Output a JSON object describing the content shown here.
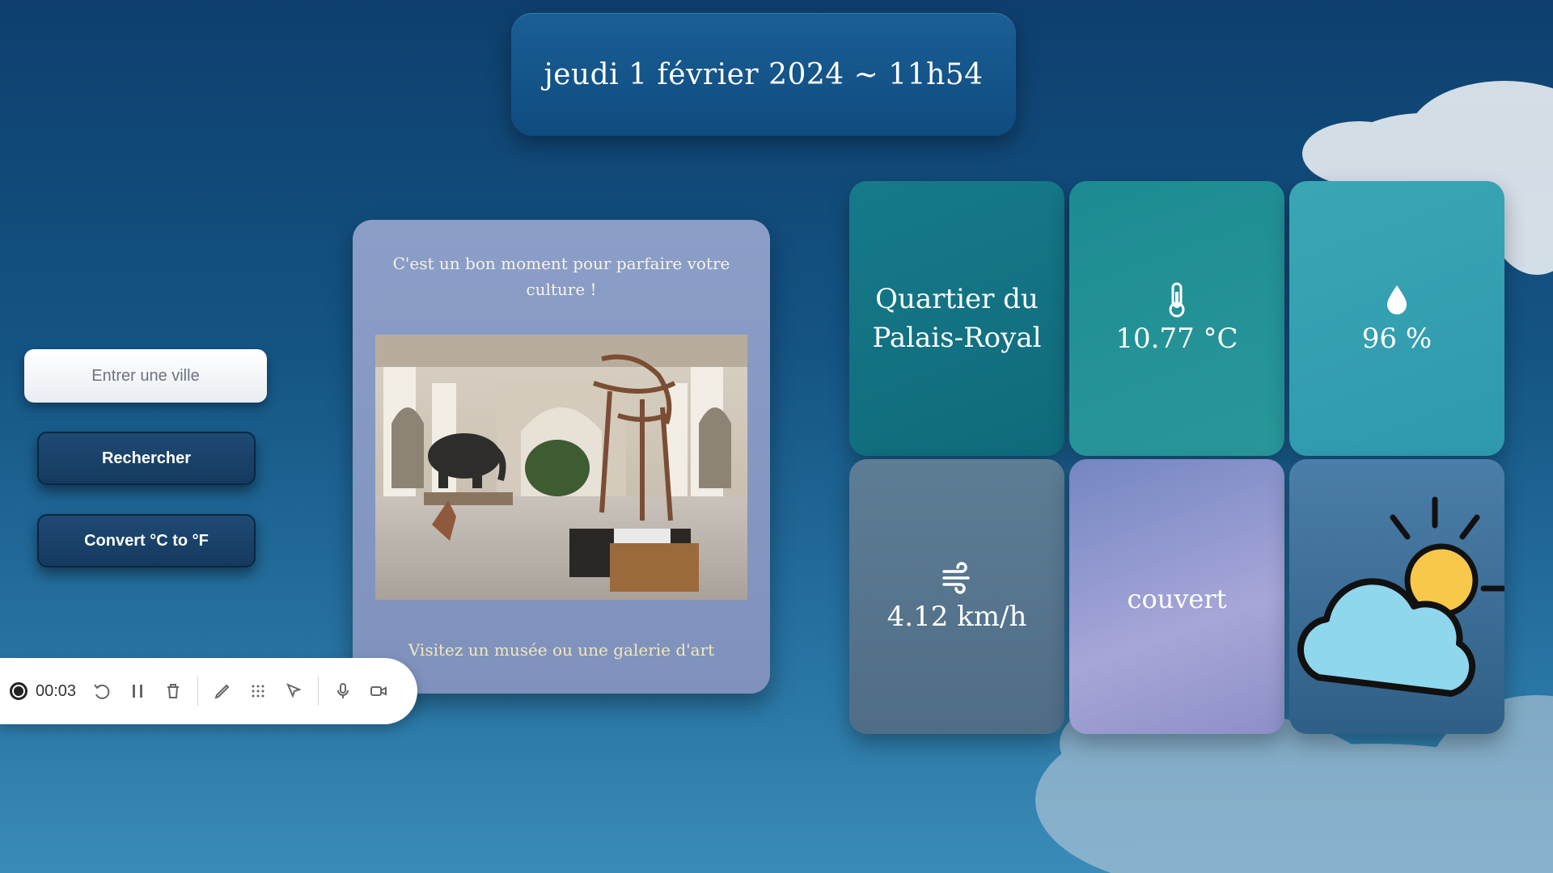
{
  "header": {
    "datetime": "jeudi 1 février 2024 ~ 11h54"
  },
  "search": {
    "placeholder": "Entrer une ville",
    "search_label": "Rechercher",
    "convert_label": "Convert °C to °F"
  },
  "suggestion": {
    "title": "C'est un bon moment pour parfaire votre culture !",
    "footer": "Visitez un musée ou une galerie d'art"
  },
  "weather": {
    "city": "Quartier du Palais-Royal",
    "temperature": "10.77 °C",
    "humidity": "96 %",
    "wind": "4.12 km/h",
    "description": "couvert",
    "temperature_icon": "thermometer-icon",
    "humidity_icon": "droplet-icon",
    "wind_icon": "wind-icon",
    "condition_icon": "partly-cloudy-icon"
  },
  "recorder": {
    "time": "00:03"
  },
  "colors": {
    "accent": "#145484",
    "button": "#1f4a73",
    "footer_text": "#f3e7b8"
  }
}
